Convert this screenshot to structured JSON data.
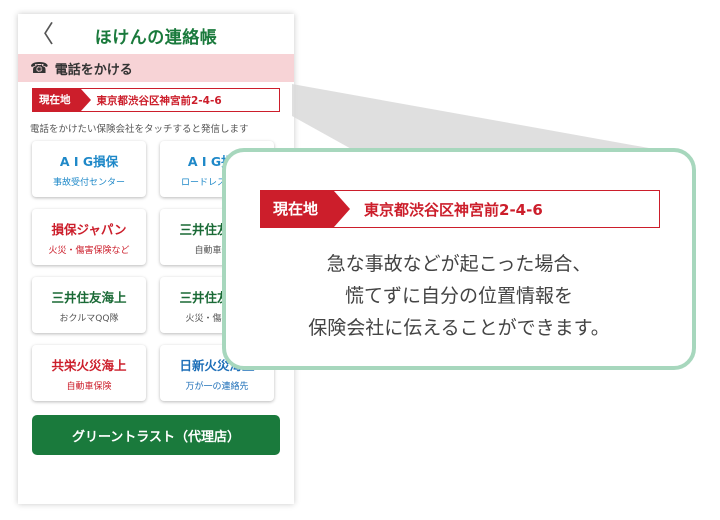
{
  "nav": {
    "back_icon": "chevron-left-icon",
    "back_glyph": "〈",
    "title": "ほけんの連絡帳"
  },
  "call_bar": {
    "icon": "phone-icon",
    "icon_glyph": "☎",
    "label": "電話をかける"
  },
  "location": {
    "label": "現在地",
    "address": "東京都渋谷区神宮前2-4-6"
  },
  "instruction": "電話をかけたい保険会社をタッチすると発信します",
  "cards": [
    {
      "name": "A I G損保",
      "desc": "事故受付センター",
      "name_color": "#1e88c8",
      "desc_color": "#1e88c8"
    },
    {
      "name": "A I G損保",
      "desc": "ロードレスキュー",
      "name_color": "#1e88c8",
      "desc_color": "#1e88c8"
    },
    {
      "name": "損保ジャパン",
      "desc": "火災・傷害保険など",
      "name_color": "#cc1e2b",
      "desc_color": "#cc1e2b"
    },
    {
      "name": "三井住友海上",
      "desc": "自動車保険",
      "name_color": "#1a6a36",
      "desc_color": "#555555"
    },
    {
      "name": "三井住友海上",
      "desc": "おクルマQQ隊",
      "name_color": "#1a6a36",
      "desc_color": "#555555"
    },
    {
      "name": "三井住友海上",
      "desc": "火災・傷害保険",
      "name_color": "#1a6a36",
      "desc_color": "#555555"
    },
    {
      "name": "共栄火災海上",
      "desc": "自動車保険",
      "name_color": "#cc1e2b",
      "desc_color": "#cc1e2b"
    },
    {
      "name": "日新火災海上",
      "desc": "万が一の連絡先",
      "name_color": "#1e6fb8",
      "desc_color": "#1e6fb8"
    }
  ],
  "agent_button": {
    "label": "グリーントラスト（代理店）"
  },
  "callout": {
    "lines": [
      "急な事故などが起こった場合、",
      "慌てずに自分の位置情報を",
      "保険会社に伝えることができます。"
    ]
  },
  "colors": {
    "brand_green": "#1a7a3c",
    "alert_red": "#cc1e2b",
    "call_bar_pink": "#f7d3d6",
    "callout_border": "#a7d7bd"
  }
}
